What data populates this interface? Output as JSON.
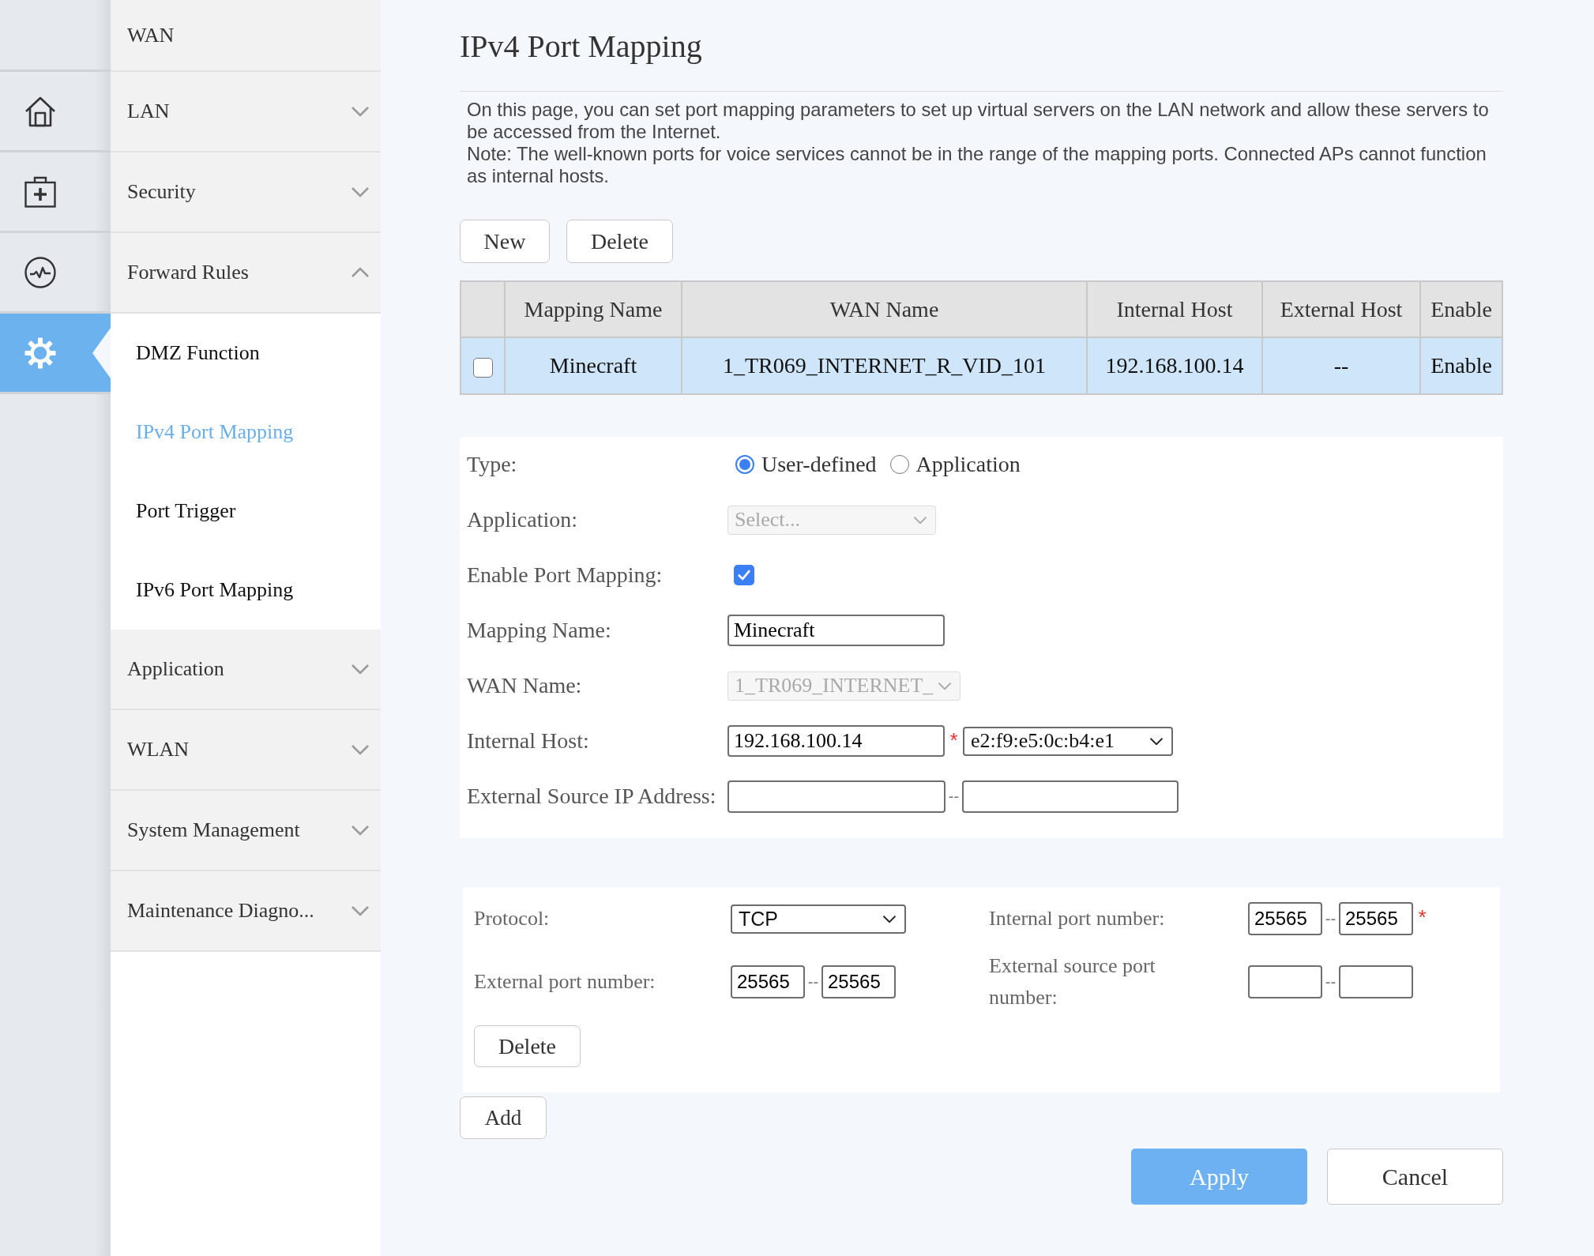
{
  "rail": [
    {
      "selected": false
    },
    {
      "selected": false
    },
    {
      "selected": false
    },
    {
      "selected": false
    },
    {
      "selected": true
    }
  ],
  "menu": [
    {
      "label": "WAN"
    },
    {
      "label": "LAN",
      "expanded": false
    },
    {
      "label": "Security",
      "expanded": false
    },
    {
      "label": "Forward Rules",
      "expanded": true,
      "children": [
        {
          "label": "DMZ Function",
          "selected": false
        },
        {
          "label": "IPv4 Port Mapping",
          "selected": true
        },
        {
          "label": "Port Trigger",
          "selected": false
        },
        {
          "label": "IPv6 Port Mapping",
          "selected": false
        }
      ]
    },
    {
      "label": "Application",
      "expanded": false
    },
    {
      "label": "WLAN",
      "expanded": false
    },
    {
      "label": "System Management",
      "expanded": false
    },
    {
      "label": "Maintenance Diagno...",
      "expanded": false
    }
  ],
  "page": {
    "title": "IPv4 Port Mapping",
    "description": [
      "On this page, you can set port mapping parameters to set up virtual servers on the LAN network and allow these servers to be accessed from the Internet.",
      "Note: The well-known ports for voice services cannot be in the range of the mapping ports. Connected APs cannot function as internal hosts."
    ]
  },
  "toolbar": {
    "buttons": [
      "New",
      "Delete"
    ]
  },
  "table": {
    "columns": [
      "Mapping Name",
      "WAN Name",
      "Internal Host",
      "External Host",
      "Enable"
    ],
    "rows": [
      {
        "selected": true,
        "checked": false,
        "cells": [
          "Minecraft",
          "1_TR069_INTERNET_R_VID_101",
          "192.168.100.14",
          "--",
          "Enable"
        ]
      }
    ]
  },
  "mapping_form": {
    "fields": [
      {
        "kind": "radio",
        "label": "Type:",
        "options": [
          {
            "label": "User-defined",
            "selected": true
          },
          {
            "label": "Application",
            "selected": false
          }
        ]
      },
      {
        "kind": "select",
        "label": "Application:",
        "placeholder": "Select...",
        "disabled": true
      },
      {
        "kind": "checkbox",
        "label": "Enable Port Mapping:",
        "checked": true
      },
      {
        "kind": "input",
        "label": "Mapping Name:",
        "value": "Minecraft"
      },
      {
        "kind": "select",
        "label": "WAN Name:",
        "value": "1_TR069_INTERNET_",
        "disabled": true
      },
      {
        "kind": "input",
        "label": "Internal Host:",
        "value": "192.168.100.14",
        "required_mark": "*",
        "device_select": "e2:f9:e5:0c:b4:e1"
      },
      {
        "kind": "range",
        "label": "External Source IP Address:",
        "separator": "--"
      }
    ]
  },
  "port_rules": [
    {
      "protocol": {
        "label": "Protocol:",
        "value": "TCP"
      },
      "internal_port": {
        "label": "Internal port number:",
        "from": "25565",
        "separator": "--",
        "to": "25565",
        "required_mark": "*"
      },
      "external_port": {
        "label": "External port number:",
        "from": "25565",
        "separator": "--",
        "to": "25565"
      },
      "external_source_port": {
        "label": "External source port number:",
        "separator": "--"
      },
      "delete_button": "Delete"
    }
  ],
  "add_button": "Add",
  "actions": [
    {
      "label": "Apply",
      "kind": "primary"
    },
    {
      "label": "Cancel",
      "kind": "secondary"
    }
  ]
}
